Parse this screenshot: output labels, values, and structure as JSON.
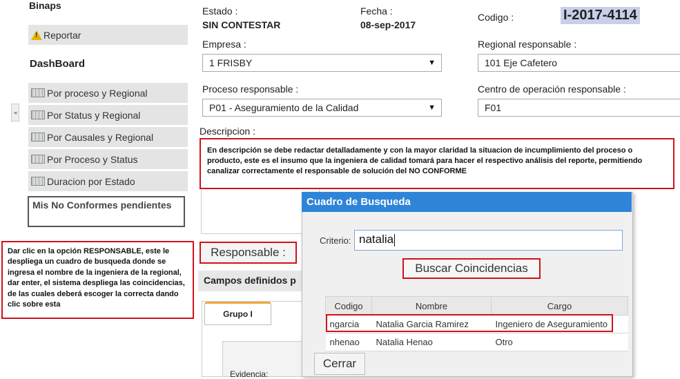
{
  "sidebar": {
    "brand": "Binaps",
    "report_label": "Reportar",
    "dashboard_title": "DashBoard",
    "items": [
      {
        "label": "Por proceso y Regional"
      },
      {
        "label": "Por Status y Regional"
      },
      {
        "label": "Por Causales y Regional"
      },
      {
        "label": "Por Proceso y Status"
      },
      {
        "label": "Duracion por Estado"
      }
    ],
    "pending_label": "Mis No Conformes pendientes",
    "collapse_glyph": "◂"
  },
  "form": {
    "estado_label": "Estado :",
    "estado_value": "SIN CONTESTAR",
    "fecha_label": "Fecha :",
    "fecha_value": "08-sep-2017",
    "codigo_label": "Codigo :",
    "codigo_value": "I-2017-4114",
    "empresa_label": "Empresa :",
    "empresa_value": "1 FRISBY",
    "regional_label": "Regional responsable :",
    "regional_value": "101 Eje Cafetero",
    "proceso_label": "Proceso responsable :",
    "proceso_value": "P01 - Aseguramiento de la Calidad",
    "centro_label": "Centro de operación responsable :",
    "centro_value": "F01",
    "descripcion_label": "Descripcion :",
    "descripcion_note": "En descripción se debe redactar  detalladamente  y con la mayor claridad la situacion de incumplimiento del proceso  o producto, este es el insumo que la ingeniera de calidad tomará para hacer  el respectivo análisis del reporte, permitiendo canalizar correctamente  el responsable de solución del NO CONFORME",
    "responsable_button": "Responsable :",
    "campos_label": "Campos definidos p",
    "tab_label": "Grupo I",
    "evidencia_label": "Evidencia:",
    "dropdown_arrow": "▼"
  },
  "left_note": "Dar clic en la opción RESPONSABLE, este le despliega un  cuadro  de busqueda donde se ingresa el nombre de la ingeniera de la regional, dar enter, el sistema despliega las coincidencias, de las cuales deberá escoger la correcta dando clic sobre esta",
  "dialog": {
    "title": "Cuadro de Busqueda",
    "criterio_label": "Criterio:",
    "criterio_value": "natalia",
    "search_button": "Buscar Coincidencias",
    "columns": [
      "Codigo",
      "Nombre",
      "Cargo"
    ],
    "rows": [
      {
        "codigo": "ngarcia",
        "nombre": "Natalia Garcia Ramirez",
        "cargo": "Ingeniero de Aseguramiento"
      },
      {
        "codigo": "nhenao",
        "nombre": "Natalia Henao",
        "cargo": "Otro"
      }
    ],
    "close_button": "Cerrar"
  },
  "colors": {
    "highlight_red": "#d0101a",
    "dialog_title_bg": "#2e84d8",
    "code_bg": "#c8cfe8",
    "tab_accent": "#f0a83c"
  }
}
